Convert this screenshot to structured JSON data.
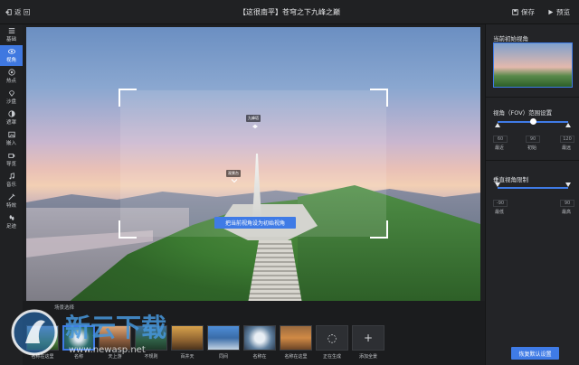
{
  "topbar": {
    "back_label": "返 回",
    "title": "【这很南平】苍穹之下九峰之巅",
    "save_label": "保存",
    "preview_label": "预览"
  },
  "sidebar": {
    "items": [
      {
        "label": "基础",
        "icon": "list-icon",
        "active": false
      },
      {
        "label": "视角",
        "icon": "eye-icon",
        "active": true
      },
      {
        "label": "热点",
        "icon": "hotspot-icon",
        "active": false
      },
      {
        "label": "沙盘",
        "icon": "map-pin-icon",
        "active": false
      },
      {
        "label": "遮罩",
        "icon": "mask-icon",
        "active": false
      },
      {
        "label": "嵌入",
        "icon": "image-icon",
        "active": false
      },
      {
        "label": "导览",
        "icon": "camera-icon",
        "active": false
      },
      {
        "label": "音乐",
        "icon": "music-icon",
        "active": false
      },
      {
        "label": "特效",
        "icon": "effects-icon",
        "active": false
      },
      {
        "label": "足迹",
        "icon": "footprint-icon",
        "active": false
      }
    ]
  },
  "preview": {
    "hotspot_label_1": "九峰塔",
    "hotspot_label_2": "观景台",
    "set_initial_button": "把当前视角设为初始视角"
  },
  "bottom": {
    "scene_tab": "场景选择",
    "thumbs": [
      {
        "label": "名称在这里",
        "selected": false
      },
      {
        "label": "名称",
        "selected": true
      },
      {
        "label": "天上游",
        "selected": false
      },
      {
        "label": "不规则",
        "selected": false
      },
      {
        "label": "百井天",
        "selected": false
      },
      {
        "label": "同间",
        "selected": false
      },
      {
        "label": "名称在",
        "selected": false
      },
      {
        "label": "名称在这里",
        "selected": false
      }
    ],
    "generating_label": "正在生成",
    "add_scene_label": "添加全景"
  },
  "right_panel": {
    "initial_view_title": "当前初始视角",
    "fov_title": "视角（FOV）范围设置",
    "fov_min_value": "60",
    "fov_init_value": "90",
    "fov_max_value": "120",
    "fov_min_label": "最近",
    "fov_init_label": "初始",
    "fov_max_label": "最远",
    "vertical_title": "垂直视角限制",
    "vert_min_value": "-90",
    "vert_max_value": "90",
    "vert_min_label": "最低",
    "vert_max_label": "最高",
    "reset_button": "恢复默认设置"
  },
  "watermark": {
    "text": "新云下载",
    "url": "www.newasp.net"
  },
  "colors": {
    "accent": "#3f7be6",
    "panel": "#232427",
    "topbar": "#202123"
  }
}
